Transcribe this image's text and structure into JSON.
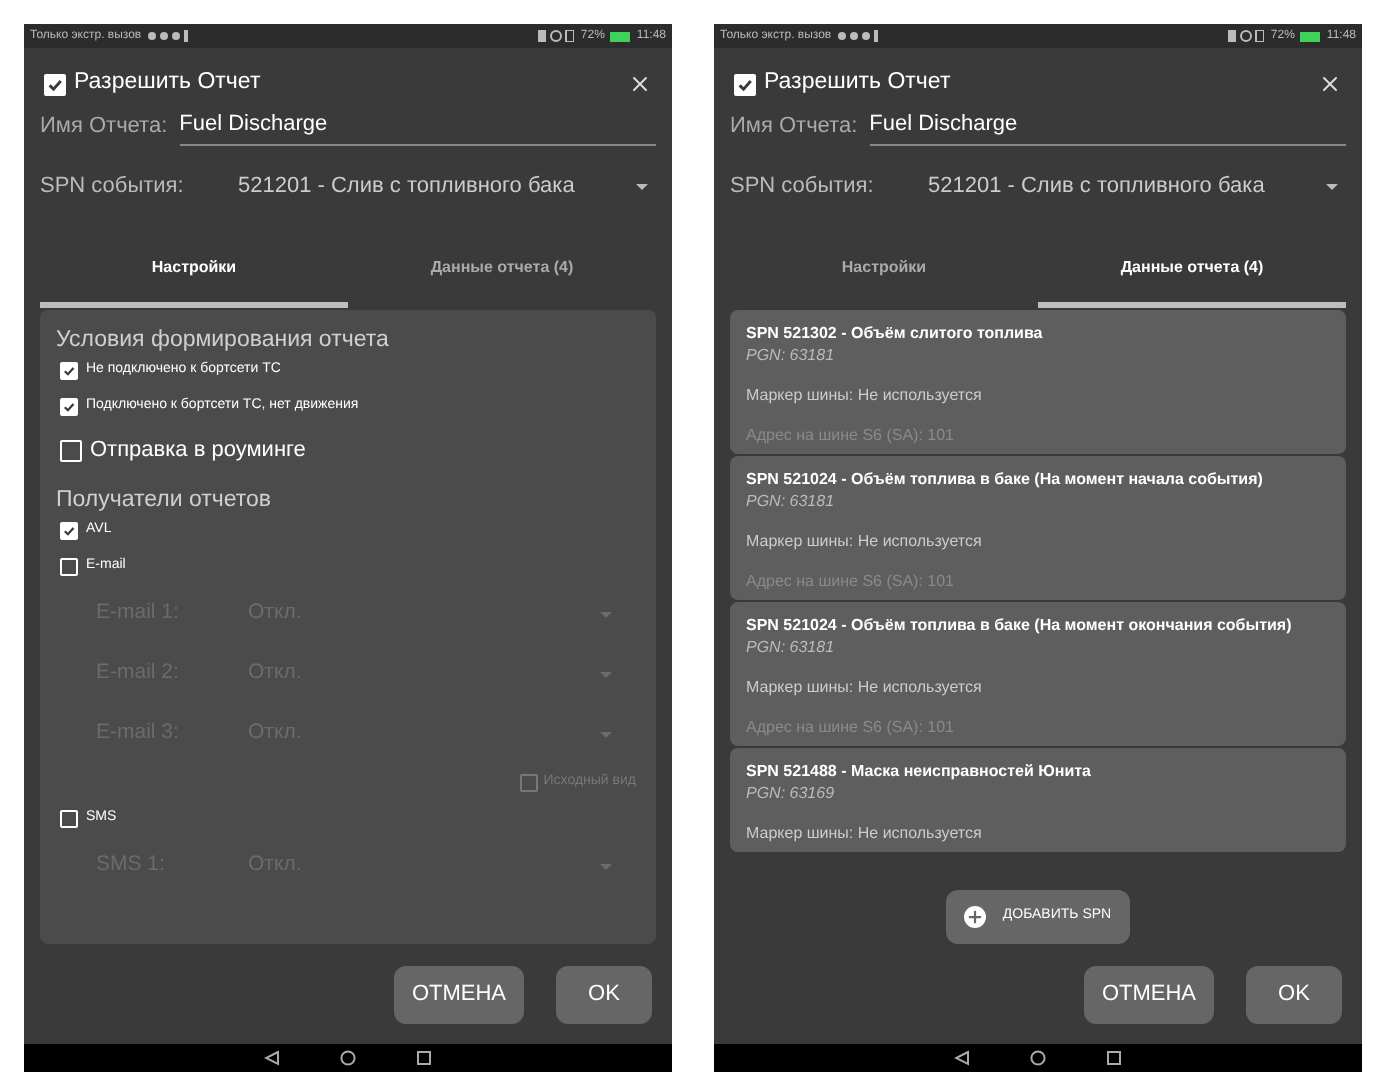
{
  "screens": [
    {
      "status_bar": {
        "carrier": "Только экстр. вызов",
        "battery": "72%",
        "time": "11:48"
      },
      "enable": {
        "label": "Разрешить Отчет",
        "checked": true
      },
      "name_field": {
        "label": "Имя Отчета:",
        "value": "Fuel Discharge"
      },
      "spn_select": {
        "label": "SPN события:",
        "value": "521201 - Слив с топливного бака"
      },
      "tabs": [
        {
          "label": "Настройки",
          "selected": true
        },
        {
          "label": "Данные отчета (4)",
          "selected": false
        }
      ],
      "content": {
        "kind": "settings",
        "items": [
          {
            "kind": "heading",
            "label": "Условия формирования отчета"
          },
          {
            "kind": "check",
            "label": "Не подключено к бортсети ТС",
            "checked": true
          },
          {
            "kind": "check",
            "label": "Подключено к бортсети ТС, нет движения",
            "checked": true
          },
          {
            "kind": "option",
            "label": "Отправка в роуминге",
            "checked": false
          },
          {
            "kind": "heading",
            "label": "Получатели отчетов"
          },
          {
            "kind": "check",
            "label": "AVL",
            "checked": true
          },
          {
            "kind": "check",
            "label": "E-mail",
            "checked": false
          },
          {
            "kind": "field",
            "label": "E-mail 1:",
            "value": "Откл.",
            "disabled": true
          },
          {
            "kind": "field",
            "label": "E-mail 2:",
            "value": "Откл.",
            "disabled": true
          },
          {
            "kind": "field",
            "label": "E-mail 3:",
            "value": "Откл.",
            "disabled": true
          },
          {
            "kind": "check_right",
            "label": "Исходный вид",
            "checked": false,
            "disabled": true
          },
          {
            "kind": "check",
            "label": "SMS",
            "checked": false
          },
          {
            "kind": "field",
            "label": "SMS 1:",
            "value": "Откл.",
            "disabled": true
          }
        ]
      },
      "buttons": [
        "ОТМЕНА",
        "OK"
      ]
    },
    {
      "status_bar": {
        "carrier": "Только экстр. вызов",
        "battery": "72%",
        "time": "11:48"
      },
      "enable": {
        "label": "Разрешить Отчет",
        "checked": true
      },
      "name_field": {
        "label": "Имя Отчета:",
        "value": "Fuel Discharge"
      },
      "spn_select": {
        "label": "SPN события:",
        "value": "521201 - Слив с топливного бака"
      },
      "tabs": [
        {
          "label": "Настройки",
          "selected": false
        },
        {
          "label": "Данные отчета (4)",
          "selected": true
        }
      ],
      "content": {
        "kind": "spn_list",
        "cards": [
          {
            "title": "SPN 521302 - Объём слитого топлива",
            "pgn": "PGN: 63181",
            "marker": "Маркер шины: Не используется",
            "address": "Адрес на шине S6 (SA): 101"
          },
          {
            "title": "SPN 521024 - Объём топлива в баке (На момент начала события)",
            "pgn": "PGN: 63181",
            "marker": "Маркер шины: Не используется",
            "address": "Адрес на шине S6 (SA): 101"
          },
          {
            "title": "SPN 521024 - Объём топлива в баке (На момент окончания события)",
            "pgn": "PGN: 63181",
            "marker": "Маркер шины: Не используется",
            "address": "Адрес на шине S6 (SA): 101"
          },
          {
            "title": "SPN 521488 - Маска неисправностей Юнита",
            "pgn": "PGN: 63169",
            "marker": "Маркер шины: Не используется"
          }
        ],
        "add_button": "ДОБАВИТЬ SPN"
      },
      "buttons": [
        "ОТМЕНА",
        "OK"
      ]
    }
  ]
}
